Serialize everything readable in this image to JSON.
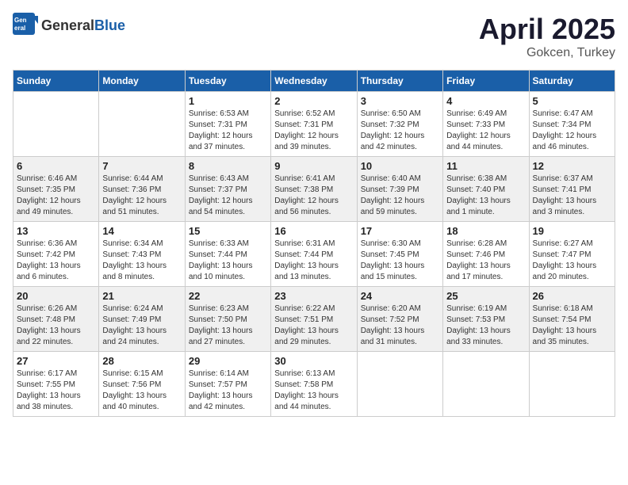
{
  "header": {
    "logo": {
      "general": "General",
      "blue": "Blue"
    },
    "month": "April 2025",
    "location": "Gokcen, Turkey"
  },
  "weekdays": [
    "Sunday",
    "Monday",
    "Tuesday",
    "Wednesday",
    "Thursday",
    "Friday",
    "Saturday"
  ],
  "weeks": [
    [
      {
        "day": "",
        "sunrise": "",
        "sunset": "",
        "daylight": ""
      },
      {
        "day": "",
        "sunrise": "",
        "sunset": "",
        "daylight": ""
      },
      {
        "day": "1",
        "sunrise": "Sunrise: 6:53 AM",
        "sunset": "Sunset: 7:31 PM",
        "daylight": "Daylight: 12 hours and 37 minutes."
      },
      {
        "day": "2",
        "sunrise": "Sunrise: 6:52 AM",
        "sunset": "Sunset: 7:31 PM",
        "daylight": "Daylight: 12 hours and 39 minutes."
      },
      {
        "day": "3",
        "sunrise": "Sunrise: 6:50 AM",
        "sunset": "Sunset: 7:32 PM",
        "daylight": "Daylight: 12 hours and 42 minutes."
      },
      {
        "day": "4",
        "sunrise": "Sunrise: 6:49 AM",
        "sunset": "Sunset: 7:33 PM",
        "daylight": "Daylight: 12 hours and 44 minutes."
      },
      {
        "day": "5",
        "sunrise": "Sunrise: 6:47 AM",
        "sunset": "Sunset: 7:34 PM",
        "daylight": "Daylight: 12 hours and 46 minutes."
      }
    ],
    [
      {
        "day": "6",
        "sunrise": "Sunrise: 6:46 AM",
        "sunset": "Sunset: 7:35 PM",
        "daylight": "Daylight: 12 hours and 49 minutes."
      },
      {
        "day": "7",
        "sunrise": "Sunrise: 6:44 AM",
        "sunset": "Sunset: 7:36 PM",
        "daylight": "Daylight: 12 hours and 51 minutes."
      },
      {
        "day": "8",
        "sunrise": "Sunrise: 6:43 AM",
        "sunset": "Sunset: 7:37 PM",
        "daylight": "Daylight: 12 hours and 54 minutes."
      },
      {
        "day": "9",
        "sunrise": "Sunrise: 6:41 AM",
        "sunset": "Sunset: 7:38 PM",
        "daylight": "Daylight: 12 hours and 56 minutes."
      },
      {
        "day": "10",
        "sunrise": "Sunrise: 6:40 AM",
        "sunset": "Sunset: 7:39 PM",
        "daylight": "Daylight: 12 hours and 59 minutes."
      },
      {
        "day": "11",
        "sunrise": "Sunrise: 6:38 AM",
        "sunset": "Sunset: 7:40 PM",
        "daylight": "Daylight: 13 hours and 1 minute."
      },
      {
        "day": "12",
        "sunrise": "Sunrise: 6:37 AM",
        "sunset": "Sunset: 7:41 PM",
        "daylight": "Daylight: 13 hours and 3 minutes."
      }
    ],
    [
      {
        "day": "13",
        "sunrise": "Sunrise: 6:36 AM",
        "sunset": "Sunset: 7:42 PM",
        "daylight": "Daylight: 13 hours and 6 minutes."
      },
      {
        "day": "14",
        "sunrise": "Sunrise: 6:34 AM",
        "sunset": "Sunset: 7:43 PM",
        "daylight": "Daylight: 13 hours and 8 minutes."
      },
      {
        "day": "15",
        "sunrise": "Sunrise: 6:33 AM",
        "sunset": "Sunset: 7:44 PM",
        "daylight": "Daylight: 13 hours and 10 minutes."
      },
      {
        "day": "16",
        "sunrise": "Sunrise: 6:31 AM",
        "sunset": "Sunset: 7:44 PM",
        "daylight": "Daylight: 13 hours and 13 minutes."
      },
      {
        "day": "17",
        "sunrise": "Sunrise: 6:30 AM",
        "sunset": "Sunset: 7:45 PM",
        "daylight": "Daylight: 13 hours and 15 minutes."
      },
      {
        "day": "18",
        "sunrise": "Sunrise: 6:28 AM",
        "sunset": "Sunset: 7:46 PM",
        "daylight": "Daylight: 13 hours and 17 minutes."
      },
      {
        "day": "19",
        "sunrise": "Sunrise: 6:27 AM",
        "sunset": "Sunset: 7:47 PM",
        "daylight": "Daylight: 13 hours and 20 minutes."
      }
    ],
    [
      {
        "day": "20",
        "sunrise": "Sunrise: 6:26 AM",
        "sunset": "Sunset: 7:48 PM",
        "daylight": "Daylight: 13 hours and 22 minutes."
      },
      {
        "day": "21",
        "sunrise": "Sunrise: 6:24 AM",
        "sunset": "Sunset: 7:49 PM",
        "daylight": "Daylight: 13 hours and 24 minutes."
      },
      {
        "day": "22",
        "sunrise": "Sunrise: 6:23 AM",
        "sunset": "Sunset: 7:50 PM",
        "daylight": "Daylight: 13 hours and 27 minutes."
      },
      {
        "day": "23",
        "sunrise": "Sunrise: 6:22 AM",
        "sunset": "Sunset: 7:51 PM",
        "daylight": "Daylight: 13 hours and 29 minutes."
      },
      {
        "day": "24",
        "sunrise": "Sunrise: 6:20 AM",
        "sunset": "Sunset: 7:52 PM",
        "daylight": "Daylight: 13 hours and 31 minutes."
      },
      {
        "day": "25",
        "sunrise": "Sunrise: 6:19 AM",
        "sunset": "Sunset: 7:53 PM",
        "daylight": "Daylight: 13 hours and 33 minutes."
      },
      {
        "day": "26",
        "sunrise": "Sunrise: 6:18 AM",
        "sunset": "Sunset: 7:54 PM",
        "daylight": "Daylight: 13 hours and 35 minutes."
      }
    ],
    [
      {
        "day": "27",
        "sunrise": "Sunrise: 6:17 AM",
        "sunset": "Sunset: 7:55 PM",
        "daylight": "Daylight: 13 hours and 38 minutes."
      },
      {
        "day": "28",
        "sunrise": "Sunrise: 6:15 AM",
        "sunset": "Sunset: 7:56 PM",
        "daylight": "Daylight: 13 hours and 40 minutes."
      },
      {
        "day": "29",
        "sunrise": "Sunrise: 6:14 AM",
        "sunset": "Sunset: 7:57 PM",
        "daylight": "Daylight: 13 hours and 42 minutes."
      },
      {
        "day": "30",
        "sunrise": "Sunrise: 6:13 AM",
        "sunset": "Sunset: 7:58 PM",
        "daylight": "Daylight: 13 hours and 44 minutes."
      },
      {
        "day": "",
        "sunrise": "",
        "sunset": "",
        "daylight": ""
      },
      {
        "day": "",
        "sunrise": "",
        "sunset": "",
        "daylight": ""
      },
      {
        "day": "",
        "sunrise": "",
        "sunset": "",
        "daylight": ""
      }
    ]
  ]
}
